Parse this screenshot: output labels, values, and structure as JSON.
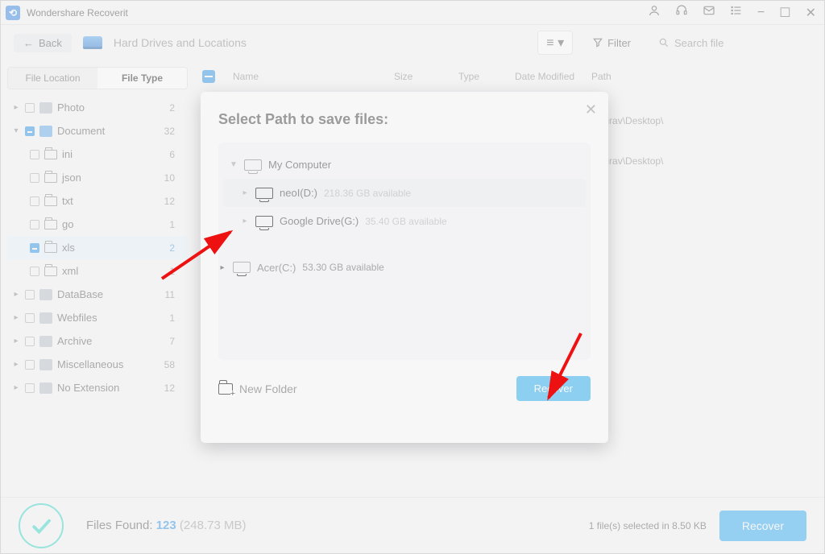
{
  "app": {
    "title": "Wondershare Recoverit"
  },
  "titlebar_icons": {
    "user": "user-icon",
    "headset": "headset-icon",
    "mail": "mail-icon",
    "list": "list-icon",
    "min": "−",
    "max": "☐",
    "close": "✕"
  },
  "toolbar": {
    "back": "Back",
    "location": "Hard Drives and Locations",
    "filter": "Filter",
    "search_placeholder": "Search file"
  },
  "sidebar": {
    "tab_location": "File Location",
    "tab_type": "File Type",
    "nodes": [
      {
        "label": "Photo",
        "count": "2"
      },
      {
        "label": "Document",
        "count": "32"
      },
      {
        "label": "ini",
        "count": "6"
      },
      {
        "label": "json",
        "count": "10"
      },
      {
        "label": "txt",
        "count": "12"
      },
      {
        "label": "go",
        "count": "1"
      },
      {
        "label": "xls",
        "count": "2"
      },
      {
        "label": "xml",
        "count": "1"
      },
      {
        "label": "DataBase",
        "count": "11"
      },
      {
        "label": "Webfiles",
        "count": "1"
      },
      {
        "label": "Archive",
        "count": "7"
      },
      {
        "label": "Miscellaneous",
        "count": "58"
      },
      {
        "label": "No Extension",
        "count": "12"
      }
    ]
  },
  "columns": {
    "name": "Name",
    "size": "Size",
    "type": "Type",
    "modified": "Date Modified",
    "path": "Path"
  },
  "rows": [
    {
      "path": "C:\\Users\\gaurav\\Desktop\\"
    },
    {
      "path": "C:\\Users\\gaurav\\Desktop\\"
    }
  ],
  "modal": {
    "title": "Select Path to save files:",
    "root": "My Computer",
    "drives": [
      {
        "label": "Acer(C:)",
        "avail": "53.30 GB available"
      },
      {
        "label": "neoI(D:)",
        "avail": "218.36 GB available"
      },
      {
        "label": "Google Drive(G:)",
        "avail": "35.40 GB available"
      }
    ],
    "new_folder": "New Folder",
    "recover": "Recover"
  },
  "status": {
    "label": "Files Found:",
    "count": "123",
    "size": "(248.73 MB)",
    "selected": "1 file(s) selected in 8.50 KB",
    "recover": "Recover"
  }
}
